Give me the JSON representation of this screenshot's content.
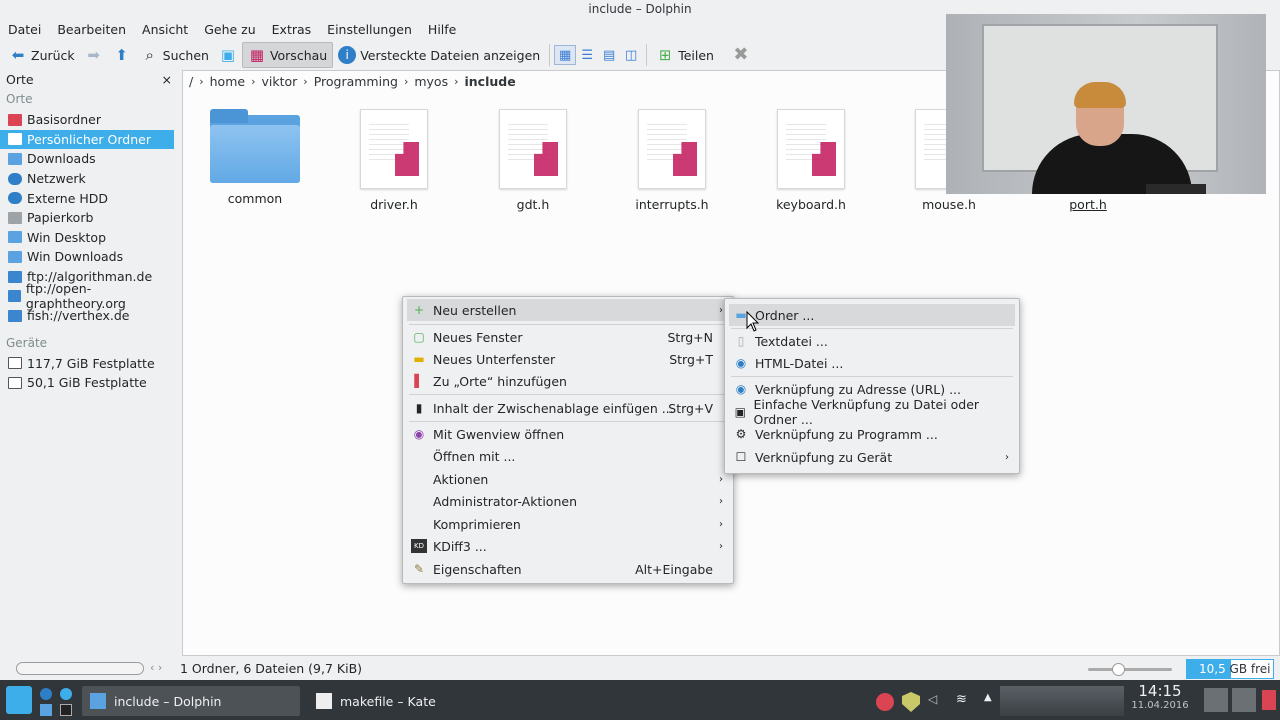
{
  "window": {
    "title": "include – Dolphin"
  },
  "menubar": [
    "Datei",
    "Bearbeiten",
    "Ansicht",
    "Gehe zu",
    "Extras",
    "Einstellungen",
    "Hilfe"
  ],
  "toolbar": {
    "back": "Zurück",
    "search": "Suchen",
    "preview": "Vorschau",
    "hidden": "Versteckte Dateien anzeigen",
    "share": "Teilen"
  },
  "places": {
    "title": "Orte",
    "group_orte": "Orte",
    "items": [
      "Basisordner",
      "Persönlicher Ordner",
      "Downloads",
      "Netzwerk",
      "Externe HDD",
      "Papierkorb",
      "Win Desktop",
      "Win Downloads",
      "ftp://algorithman.de",
      "ftp://open-graphtheory.org",
      "fish://verthex.de"
    ],
    "group_devices": "Geräte",
    "devices": [
      "117,7 GiB Festplatte",
      "50,1 GiB Festplatte"
    ]
  },
  "breadcrumb": {
    "root": "/",
    "parts": [
      "home",
      "viktor",
      "Programming",
      "myos"
    ],
    "current": "include"
  },
  "files": [
    "common",
    "driver.h",
    "gdt.h",
    "interrupts.h",
    "keyboard.h",
    "mouse.h",
    "port.h"
  ],
  "context_menu": {
    "items": [
      {
        "label": "Neu erstellen",
        "shortcut": "",
        "submenu": true
      },
      {
        "label": "Neues Fenster",
        "shortcut": "Strg+N"
      },
      {
        "label": "Neues Unterfenster",
        "shortcut": "Strg+T"
      },
      {
        "label": "Zu „Orte“ hinzufügen",
        "shortcut": ""
      },
      {
        "label": "Inhalt der Zwischenablage einfügen ...",
        "shortcut": "Strg+V"
      },
      {
        "label": "Mit Gwenview öffnen",
        "shortcut": ""
      },
      {
        "label": "Öffnen mit ...",
        "shortcut": ""
      },
      {
        "label": "Aktionen",
        "submenu": true
      },
      {
        "label": "Administrator-Aktionen",
        "submenu": true
      },
      {
        "label": "Komprimieren",
        "submenu": true
      },
      {
        "label": "KDiff3 ...",
        "submenu": true
      },
      {
        "label": "Eigenschaften",
        "shortcut": "Alt+Eingabe"
      }
    ]
  },
  "submenu": {
    "items": [
      "Ordner ...",
      "Textdatei ...",
      "HTML-Datei ...",
      "Verknüpfung zu Adresse (URL) ...",
      "Einfache Verknüpfung zu Datei oder Ordner ...",
      "Verknüpfung zu Programm ...",
      "Verknüpfung zu Gerät"
    ]
  },
  "status": {
    "summary": "1 Ordner, 6 Dateien (9,7 KiB)",
    "free_value": "10,5",
    "free_unit": "GB frei"
  },
  "taskbar": {
    "tasks": [
      "include – Dolphin",
      "makefile – Kate"
    ],
    "time": "14:15",
    "date": "11.04.2016"
  }
}
